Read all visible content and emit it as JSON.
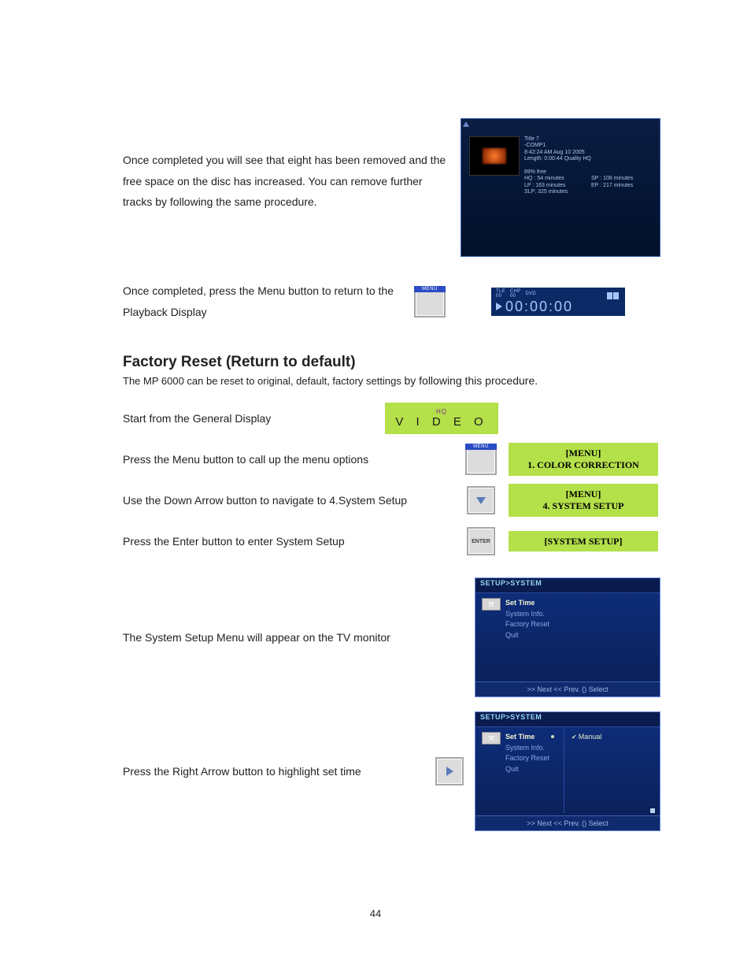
{
  "para1": "Once completed you will see that eight has been removed and the free space on the disc has increased. You can remove further tracks by following the same procedure.",
  "para2": "Once completed, press the Menu button to return to the Playback Display",
  "playback": {
    "title_line": "Title 7",
    "meta1": "-COMP1",
    "meta2": "8:42:24 AM  Aug 10  2005",
    "meta3": "Length: 0:00:44 Quality HQ",
    "free_label": "89% free",
    "hq": "HQ : 54 minutes",
    "sp": "SP : 108 minutes",
    "lp": "LP : 163 minutes",
    "ep": "EP : 217 minutes",
    "slp": "SLP: 325 minutes"
  },
  "dvd": {
    "tle": "TLE",
    "tle_v": "00",
    "chp": "CHP",
    "chp_v": "00",
    "dvd": "DVD",
    "counter": "00:00:00"
  },
  "section": {
    "heading": "Factory Reset (Return to default)",
    "intro_a": "The MP 6000 can be reset to original, default, factory settings ",
    "intro_b": "by following this procedure.",
    "step1": "Start from the General Display",
    "video_hq": "HQ",
    "video_label": "V I D E O",
    "step2": "Press the Menu button to call up the menu options",
    "bar1_a": "[MENU]",
    "bar1_b": "1. COLOR CORRECTION",
    "step3": "Use the Down Arrow button to navigate to 4.System Setup",
    "bar2_a": "[MENU]",
    "bar2_b": "4. SYSTEM SETUP",
    "step4": "Press the Enter button to enter System Setup",
    "bar3": "[SYSTEM SETUP]",
    "step5": "The System Setup Menu will appear on the TV monitor",
    "step6": "Press the Right Arrow button to highlight set time"
  },
  "setup": {
    "title": "SETUP>SYSTEM",
    "items": [
      "Set Time",
      "System Info.",
      "Factory Reset",
      "Quit"
    ],
    "manual": "Manual",
    "footer": ">> Next  << Prev.  () Select"
  },
  "buttons": {
    "menu": "MENU",
    "enter": "ENTER"
  },
  "page_number": "44"
}
